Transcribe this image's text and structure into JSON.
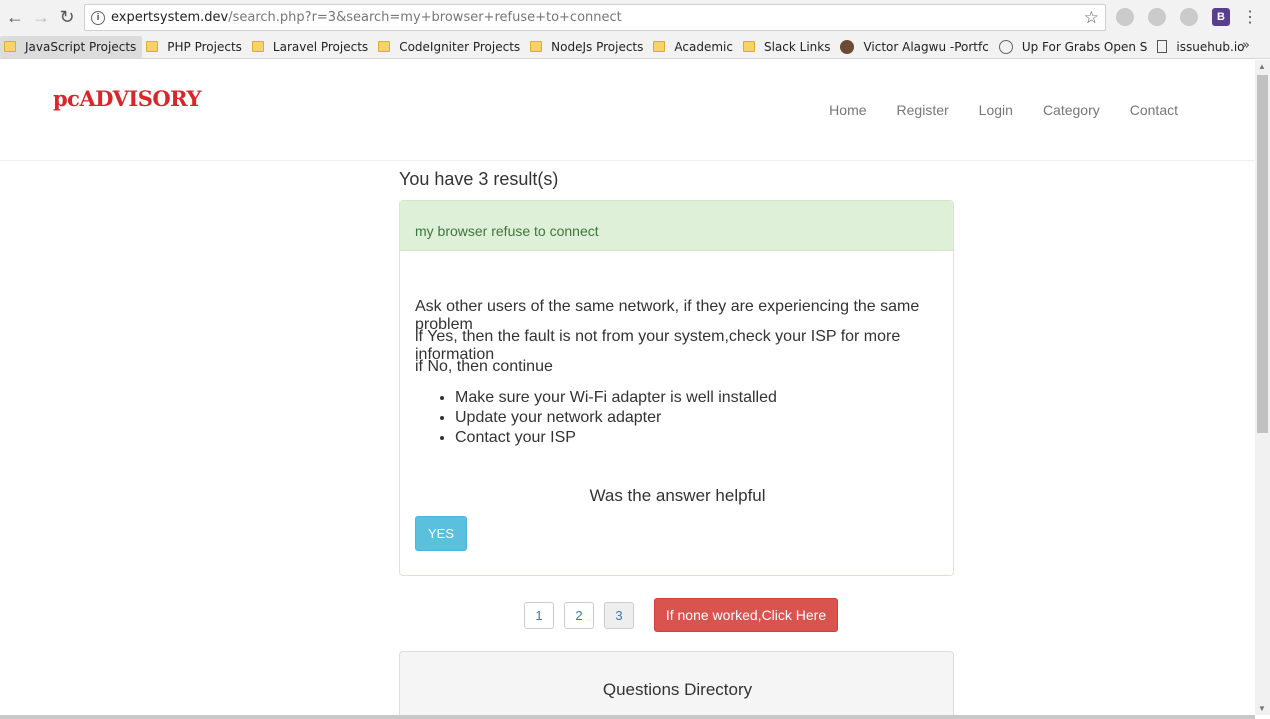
{
  "browser": {
    "url_host": "expertsystem.dev",
    "url_path": "/search.php?r=3&search=my+browser+refuse+to+connect",
    "bookmarks": [
      {
        "label": "JavaScript Projects",
        "icon": "folder-icon"
      },
      {
        "label": "PHP Projects",
        "icon": "folder-icon"
      },
      {
        "label": "Laravel Projects",
        "icon": "folder-icon"
      },
      {
        "label": "CodeIgniter Projects",
        "icon": "folder-icon"
      },
      {
        "label": "NodeJs Projects",
        "icon": "folder-icon"
      },
      {
        "label": "Academic",
        "icon": "folder-icon"
      },
      {
        "label": "Slack Links",
        "icon": "folder-icon"
      },
      {
        "label": "Victor Alagwu -Portfc",
        "icon": "avatar-icon"
      },
      {
        "label": "Up For Grabs Open S",
        "icon": "globe-icon"
      },
      {
        "label": "issuehub.io",
        "icon": "page-icon"
      }
    ],
    "more_label": "»"
  },
  "site": {
    "logo": "pcADVISORY",
    "menu": [
      "Home",
      "Register",
      "Login",
      "Category",
      "Contact"
    ]
  },
  "results": {
    "title": "You have 3 result(s)",
    "question": "my browser refuse to connect",
    "paragraphs": [
      "Ask other users of the same network, if they are experiencing the same problem",
      "if Yes, then the fault is not from your system,check your ISP for more information",
      "if No, then continue"
    ],
    "steps": [
      "Make sure your Wi-Fi adapter is well installed",
      "Update your network adapter",
      "Contact your ISP"
    ],
    "helpful_prompt": "Was the answer helpful",
    "yes_label": "YES"
  },
  "pagination": {
    "pages": [
      "1",
      "2",
      "3"
    ],
    "current": "3",
    "none_worked_label": "If none worked,Click Here"
  },
  "directory": {
    "title": "Questions Directory"
  }
}
